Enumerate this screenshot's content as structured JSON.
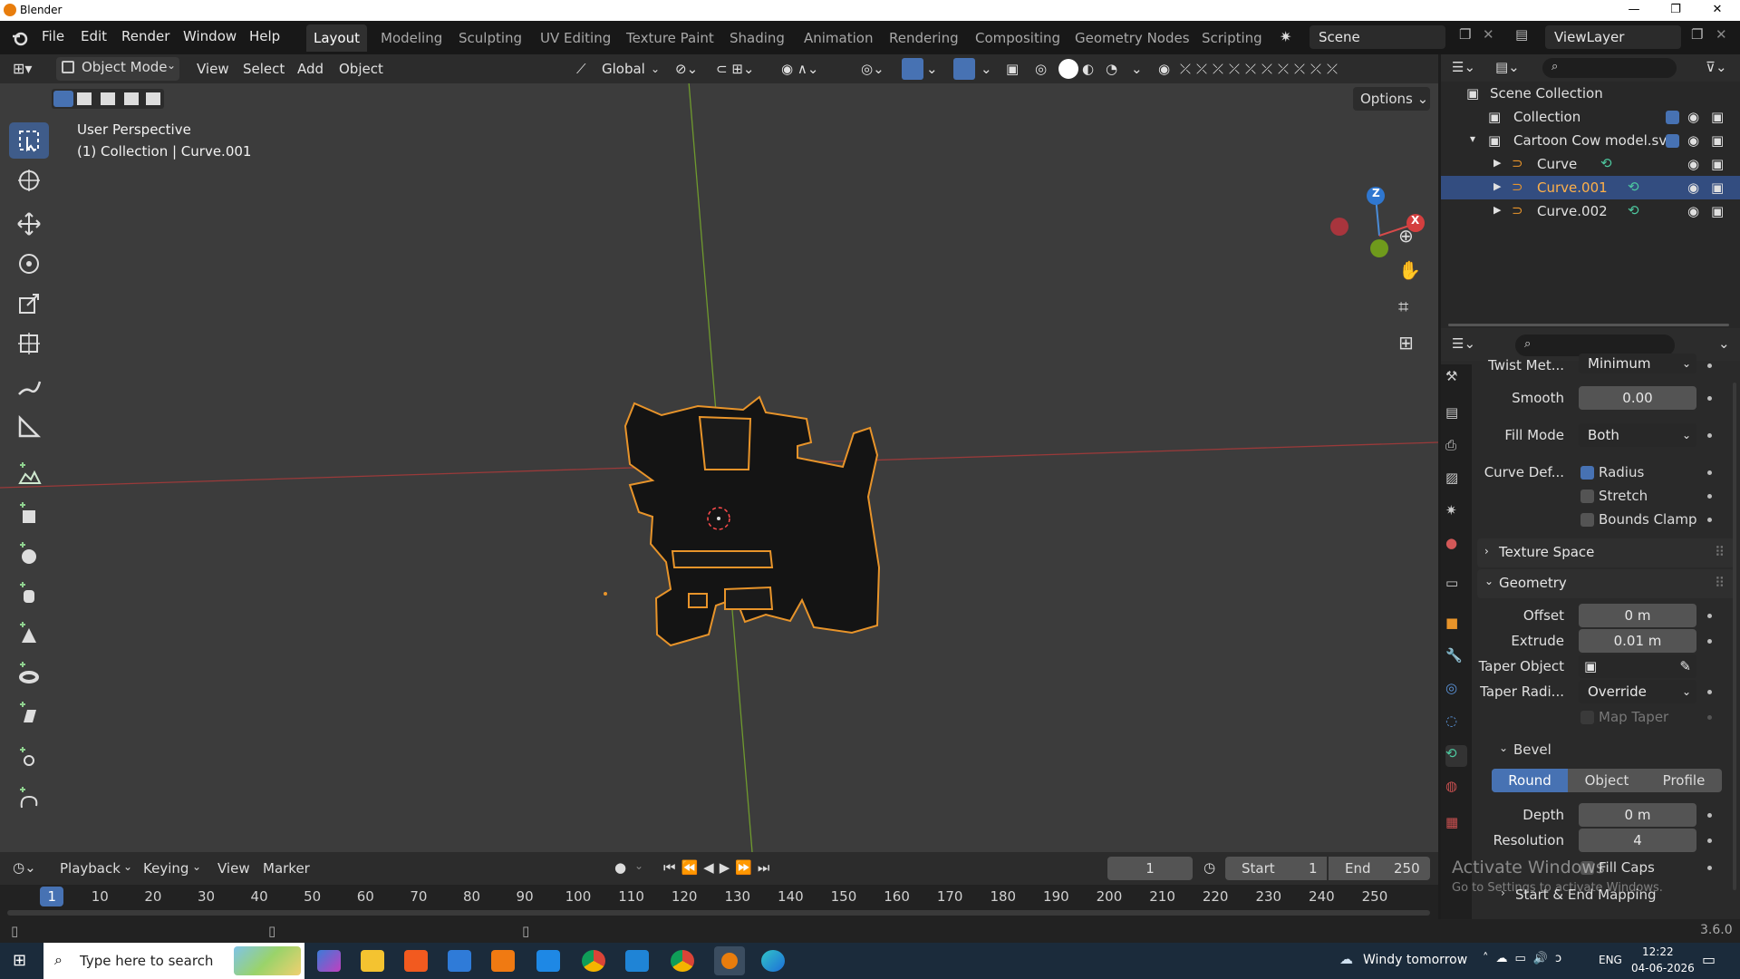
{
  "window": {
    "title": "Blender"
  },
  "menu": [
    "File",
    "Edit",
    "Render",
    "Window",
    "Help"
  ],
  "workspaces": [
    "Layout",
    "Modeling",
    "Sculpting",
    "UV Editing",
    "Texture Paint",
    "Shading",
    "Animation",
    "Rendering",
    "Compositing",
    "Geometry Nodes",
    "Scripting"
  ],
  "scene": {
    "name": "Scene",
    "view_layer": "ViewLayer"
  },
  "viewport": {
    "mode": "Object Mode",
    "header_menu": [
      "View",
      "Select",
      "Add",
      "Object"
    ],
    "orientation": "Global",
    "options_label": "Options",
    "info_line1": "User Perspective",
    "info_line2": "(1) Collection | Curve.001",
    "gizmo_axes": {
      "z": "Z",
      "x": "X"
    }
  },
  "outliner": {
    "rows": [
      {
        "label": "Scene Collection",
        "level": 0
      },
      {
        "label": "Collection",
        "level": 1
      },
      {
        "label": "Cartoon Cow model.svg",
        "level": 1
      },
      {
        "label": "Curve",
        "level": 2
      },
      {
        "label": "Curve.001",
        "level": 2,
        "selected": true
      },
      {
        "label": "Curve.002",
        "level": 2
      }
    ]
  },
  "properties": {
    "twist_method": {
      "label": "Twist Met...",
      "value": "Minimum"
    },
    "smooth": {
      "label": "Smooth",
      "value": "0.00"
    },
    "fill_mode": {
      "label": "Fill Mode",
      "value": "Both"
    },
    "curve_deform": {
      "label": "Curve Def...",
      "radius": "Radius",
      "stretch": "Stretch",
      "bounds_clamp": "Bounds Clamp"
    },
    "texture_space": "Texture Space",
    "geometry": "Geometry",
    "offset": {
      "label": "Offset",
      "value": "0 m"
    },
    "extrude": {
      "label": "Extrude",
      "value": "0.01 m"
    },
    "taper_object": {
      "label": "Taper Object"
    },
    "taper_radius": {
      "label": "Taper Radi...",
      "value": "Override"
    },
    "map_taper": "Map Taper",
    "bevel": "Bevel",
    "bevel_modes": [
      "Round",
      "Object",
      "Profile"
    ],
    "depth": {
      "label": "Depth",
      "value": "0 m"
    },
    "resolution": {
      "label": "Resolution",
      "value": "4"
    },
    "fill_caps": "Fill Caps",
    "start_end_mapping": "Start & End Mapping"
  },
  "watermark": {
    "line1": "Activate Windows",
    "line2": "Go to Settings to activate Windows."
  },
  "timeline": {
    "menu": [
      "Playback",
      "Keying",
      "View",
      "Marker"
    ],
    "current_frame": "1",
    "start_label": "Start",
    "start": "1",
    "end_label": "End",
    "end": "250",
    "ticks": [
      "1",
      "10",
      "20",
      "30",
      "40",
      "50",
      "60",
      "70",
      "80",
      "90",
      "100",
      "110",
      "120",
      "130",
      "140",
      "150",
      "160",
      "170",
      "180",
      "190",
      "200",
      "210",
      "220",
      "230",
      "240",
      "250"
    ]
  },
  "status": {
    "version": "3.6.0"
  },
  "taskbar": {
    "search_placeholder": "Type here to search",
    "weather": "Windy tomorrow",
    "lang": "ENG",
    "time": "12:22",
    "date": "04-06-2026"
  },
  "colors": {
    "accent": "#4772b3",
    "selection": "#e8942a",
    "x_axis": "#b83b3b",
    "y_axis": "#7da83a"
  }
}
